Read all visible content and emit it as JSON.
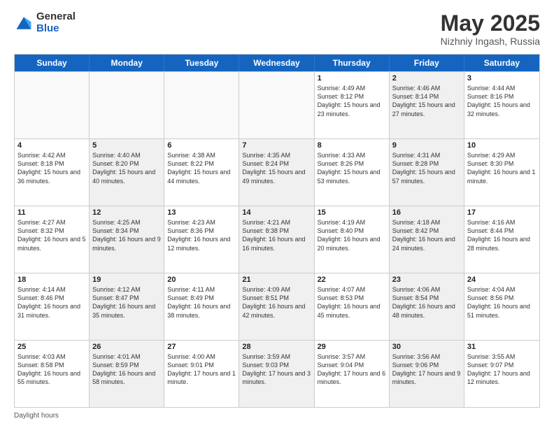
{
  "header": {
    "logo_general": "General",
    "logo_blue": "Blue",
    "title": "May 2025",
    "location": "Nizhniy Ingash, Russia"
  },
  "days_of_week": [
    "Sunday",
    "Monday",
    "Tuesday",
    "Wednesday",
    "Thursday",
    "Friday",
    "Saturday"
  ],
  "weeks": [
    [
      {
        "day": "",
        "text": "",
        "empty": true
      },
      {
        "day": "",
        "text": "",
        "empty": true
      },
      {
        "day": "",
        "text": "",
        "empty": true
      },
      {
        "day": "",
        "text": "",
        "empty": true
      },
      {
        "day": "1",
        "text": "Sunrise: 4:49 AM\nSunset: 8:12 PM\nDaylight: 15 hours\nand 23 minutes.",
        "shaded": false
      },
      {
        "day": "2",
        "text": "Sunrise: 4:46 AM\nSunset: 8:14 PM\nDaylight: 15 hours\nand 27 minutes.",
        "shaded": true
      },
      {
        "day": "3",
        "text": "Sunrise: 4:44 AM\nSunset: 8:16 PM\nDaylight: 15 hours\nand 32 minutes.",
        "shaded": false
      }
    ],
    [
      {
        "day": "4",
        "text": "Sunrise: 4:42 AM\nSunset: 8:18 PM\nDaylight: 15 hours\nand 36 minutes.",
        "shaded": false
      },
      {
        "day": "5",
        "text": "Sunrise: 4:40 AM\nSunset: 8:20 PM\nDaylight: 15 hours\nand 40 minutes.",
        "shaded": true
      },
      {
        "day": "6",
        "text": "Sunrise: 4:38 AM\nSunset: 8:22 PM\nDaylight: 15 hours\nand 44 minutes.",
        "shaded": false
      },
      {
        "day": "7",
        "text": "Sunrise: 4:35 AM\nSunset: 8:24 PM\nDaylight: 15 hours\nand 49 minutes.",
        "shaded": true
      },
      {
        "day": "8",
        "text": "Sunrise: 4:33 AM\nSunset: 8:26 PM\nDaylight: 15 hours\nand 53 minutes.",
        "shaded": false
      },
      {
        "day": "9",
        "text": "Sunrise: 4:31 AM\nSunset: 8:28 PM\nDaylight: 15 hours\nand 57 minutes.",
        "shaded": true
      },
      {
        "day": "10",
        "text": "Sunrise: 4:29 AM\nSunset: 8:30 PM\nDaylight: 16 hours\nand 1 minute.",
        "shaded": false
      }
    ],
    [
      {
        "day": "11",
        "text": "Sunrise: 4:27 AM\nSunset: 8:32 PM\nDaylight: 16 hours\nand 5 minutes.",
        "shaded": false
      },
      {
        "day": "12",
        "text": "Sunrise: 4:25 AM\nSunset: 8:34 PM\nDaylight: 16 hours\nand 9 minutes.",
        "shaded": true
      },
      {
        "day": "13",
        "text": "Sunrise: 4:23 AM\nSunset: 8:36 PM\nDaylight: 16 hours\nand 12 minutes.",
        "shaded": false
      },
      {
        "day": "14",
        "text": "Sunrise: 4:21 AM\nSunset: 8:38 PM\nDaylight: 16 hours\nand 16 minutes.",
        "shaded": true
      },
      {
        "day": "15",
        "text": "Sunrise: 4:19 AM\nSunset: 8:40 PM\nDaylight: 16 hours\nand 20 minutes.",
        "shaded": false
      },
      {
        "day": "16",
        "text": "Sunrise: 4:18 AM\nSunset: 8:42 PM\nDaylight: 16 hours\nand 24 minutes.",
        "shaded": true
      },
      {
        "day": "17",
        "text": "Sunrise: 4:16 AM\nSunset: 8:44 PM\nDaylight: 16 hours\nand 28 minutes.",
        "shaded": false
      }
    ],
    [
      {
        "day": "18",
        "text": "Sunrise: 4:14 AM\nSunset: 8:46 PM\nDaylight: 16 hours\nand 31 minutes.",
        "shaded": false
      },
      {
        "day": "19",
        "text": "Sunrise: 4:12 AM\nSunset: 8:47 PM\nDaylight: 16 hours\nand 35 minutes.",
        "shaded": true
      },
      {
        "day": "20",
        "text": "Sunrise: 4:11 AM\nSunset: 8:49 PM\nDaylight: 16 hours\nand 38 minutes.",
        "shaded": false
      },
      {
        "day": "21",
        "text": "Sunrise: 4:09 AM\nSunset: 8:51 PM\nDaylight: 16 hours\nand 42 minutes.",
        "shaded": true
      },
      {
        "day": "22",
        "text": "Sunrise: 4:07 AM\nSunset: 8:53 PM\nDaylight: 16 hours\nand 45 minutes.",
        "shaded": false
      },
      {
        "day": "23",
        "text": "Sunrise: 4:06 AM\nSunset: 8:54 PM\nDaylight: 16 hours\nand 48 minutes.",
        "shaded": true
      },
      {
        "day": "24",
        "text": "Sunrise: 4:04 AM\nSunset: 8:56 PM\nDaylight: 16 hours\nand 51 minutes.",
        "shaded": false
      }
    ],
    [
      {
        "day": "25",
        "text": "Sunrise: 4:03 AM\nSunset: 8:58 PM\nDaylight: 16 hours\nand 55 minutes.",
        "shaded": false
      },
      {
        "day": "26",
        "text": "Sunrise: 4:01 AM\nSunset: 8:59 PM\nDaylight: 16 hours\nand 58 minutes.",
        "shaded": true
      },
      {
        "day": "27",
        "text": "Sunrise: 4:00 AM\nSunset: 9:01 PM\nDaylight: 17 hours\nand 1 minute.",
        "shaded": false
      },
      {
        "day": "28",
        "text": "Sunrise: 3:59 AM\nSunset: 9:03 PM\nDaylight: 17 hours\nand 3 minutes.",
        "shaded": true
      },
      {
        "day": "29",
        "text": "Sunrise: 3:57 AM\nSunset: 9:04 PM\nDaylight: 17 hours\nand 6 minutes.",
        "shaded": false
      },
      {
        "day": "30",
        "text": "Sunrise: 3:56 AM\nSunset: 9:06 PM\nDaylight: 17 hours\nand 9 minutes.",
        "shaded": true
      },
      {
        "day": "31",
        "text": "Sunrise: 3:55 AM\nSunset: 9:07 PM\nDaylight: 17 hours\nand 12 minutes.",
        "shaded": false
      }
    ]
  ],
  "footer": {
    "label": "Daylight hours"
  }
}
